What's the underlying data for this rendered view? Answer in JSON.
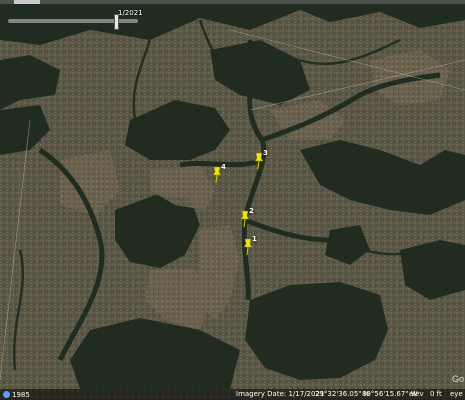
{
  "time_slider": {
    "date_label": "1/2021"
  },
  "pins": [
    {
      "label": "3"
    },
    {
      "label": "4"
    },
    {
      "label": "2"
    },
    {
      "label": "1"
    }
  ],
  "status_bar": {
    "year_label": "1985",
    "imagery_date": "Imagery Date: 1/17/2021",
    "latitude": "29°32'36.05\" N",
    "longitude": "89°56'15.67\" W",
    "elev_label": "elev",
    "elev_value": "0 ft",
    "eye_alt": "eye a"
  },
  "map_attribution": {
    "logo_text": "Go"
  },
  "colors": {
    "pin": "#f2e31a",
    "water": "#1e2a1f",
    "land": "#5b5945"
  }
}
